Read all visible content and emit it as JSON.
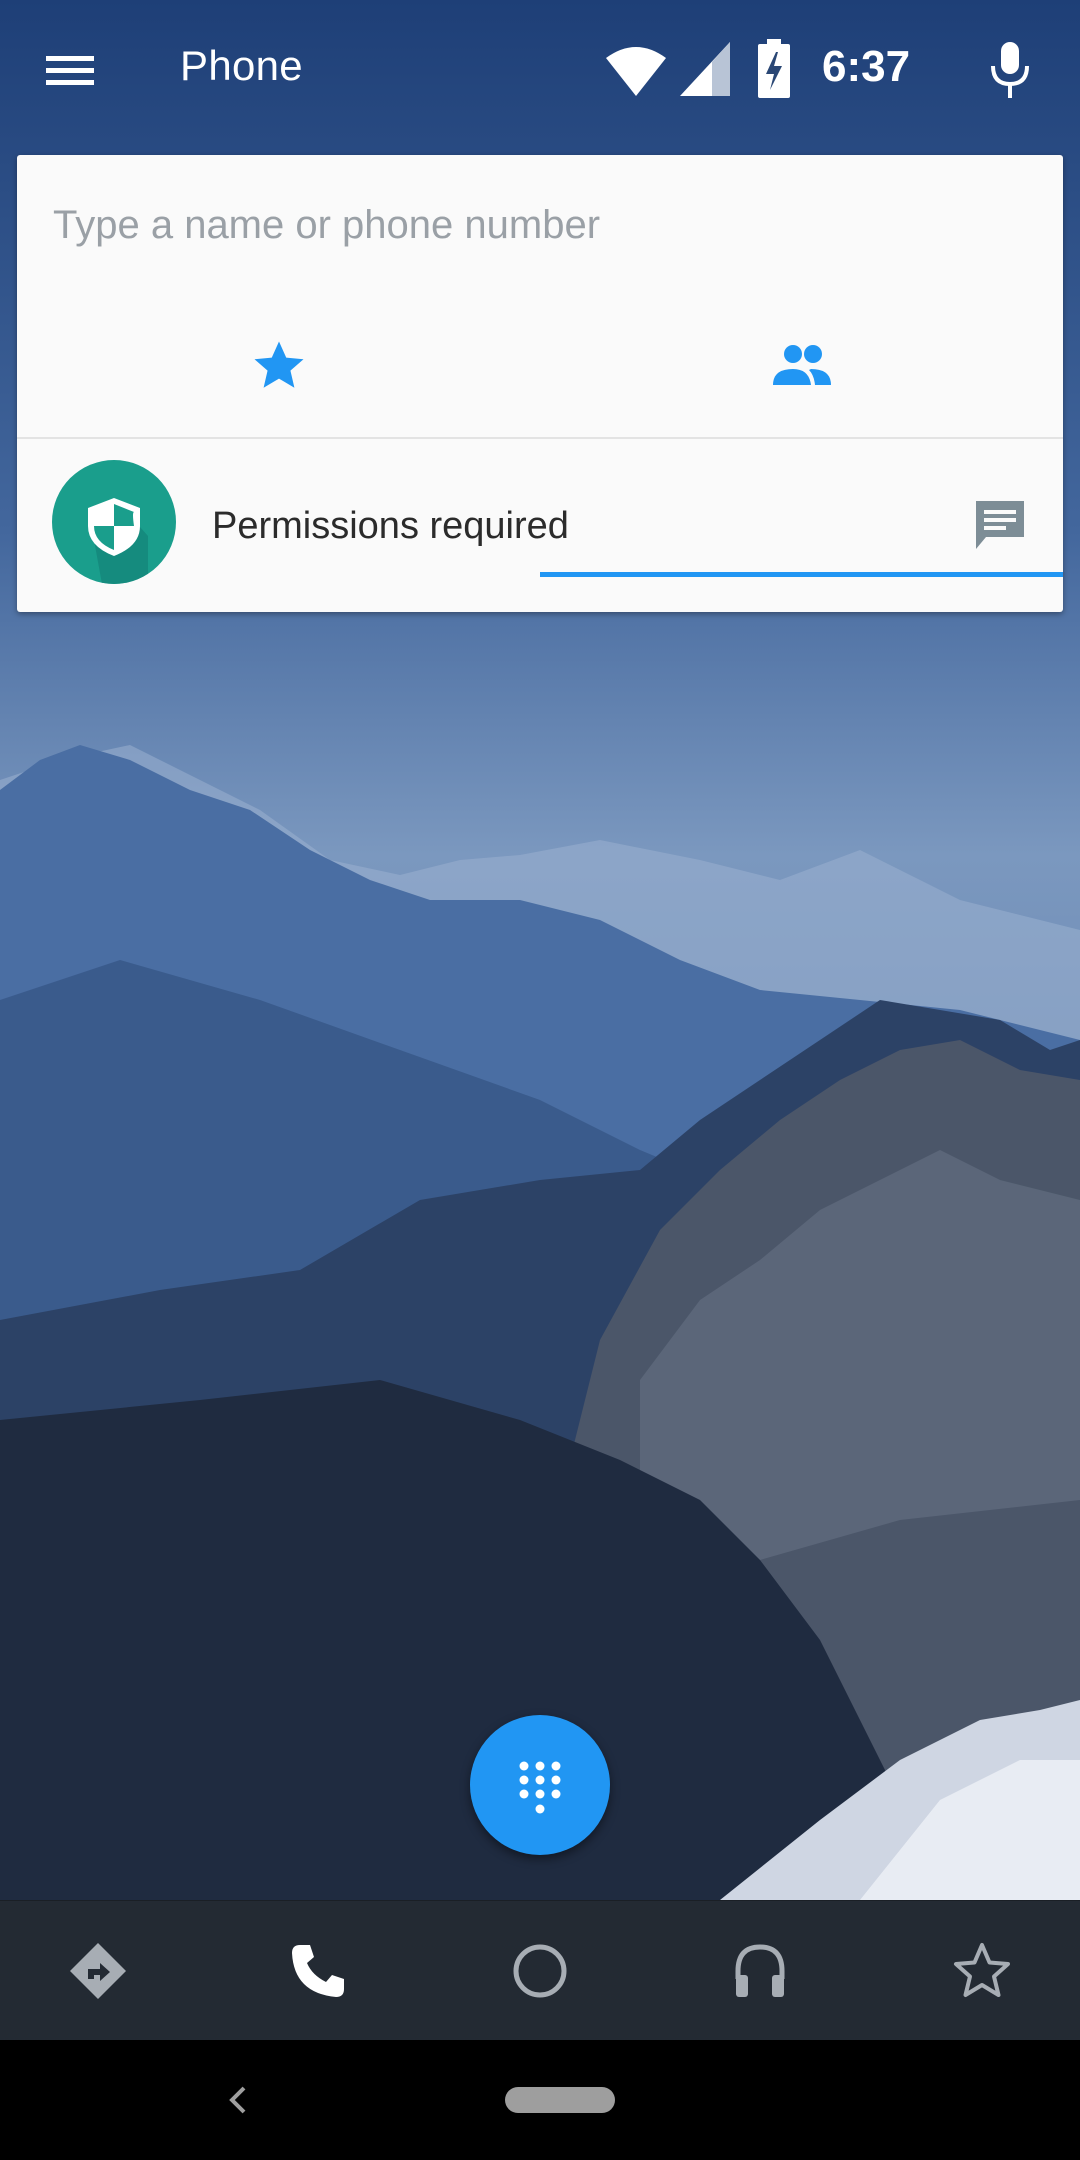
{
  "app_bar": {
    "title": "Phone",
    "menu_icon": "hamburger-menu-icon",
    "mic_icon": "microphone-icon"
  },
  "status_bar": {
    "time": "6:37",
    "icons": [
      "wifi-icon",
      "signal-icon",
      "battery-charging-icon"
    ]
  },
  "search": {
    "placeholder": "Type a name or phone number",
    "value": ""
  },
  "tabs": [
    {
      "icon": "star-icon",
      "selected": false
    },
    {
      "icon": "people-icon",
      "selected": true
    }
  ],
  "permissions_row": {
    "label": "Permissions required",
    "avatar_icon": "shield-icon",
    "action_icon": "message-icon"
  },
  "fab": {
    "icon": "dialpad-icon"
  },
  "bottom_nav": [
    {
      "icon": "navigation-icon"
    },
    {
      "icon": "phone-icon"
    },
    {
      "icon": "home-circle-icon"
    },
    {
      "icon": "headphones-icon"
    },
    {
      "icon": "star-outline-icon"
    }
  ],
  "system_nav": {
    "back_icon": "back-chevron-icon",
    "home_icon": "home-pill-icon"
  },
  "colors": {
    "accent": "#2196f3",
    "avatar_bg": "#1a9e8c",
    "nav_bar_bg": "#232a33",
    "card_bg": "#fafafa"
  }
}
